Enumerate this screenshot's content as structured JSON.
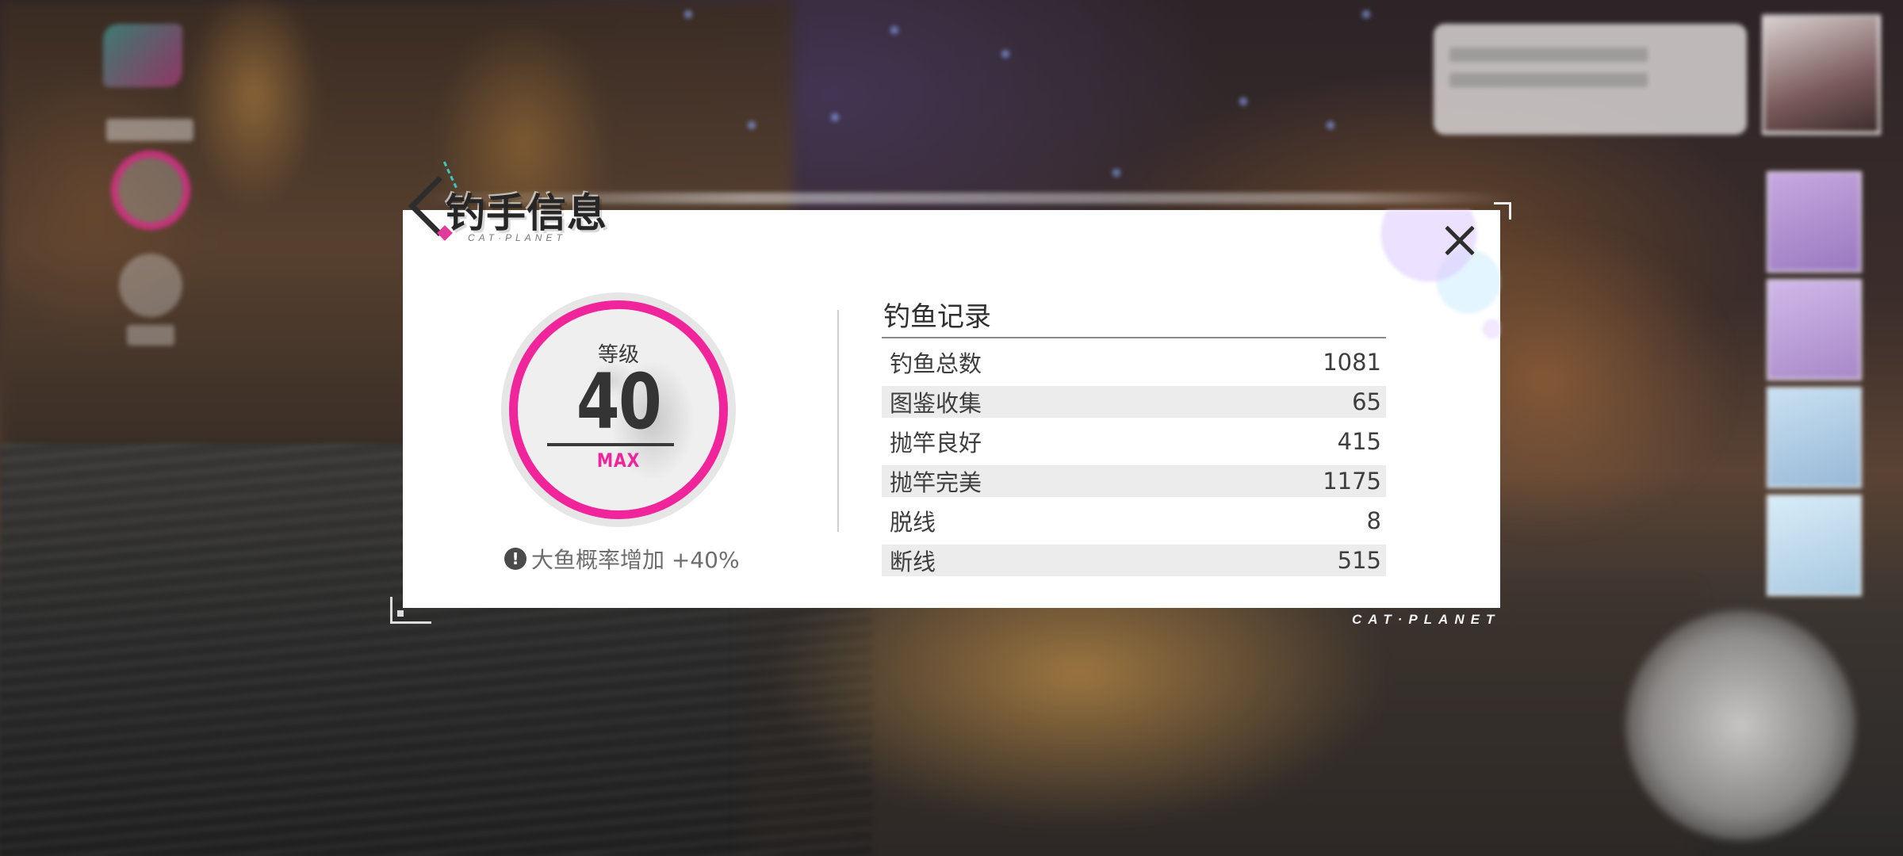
{
  "dialog": {
    "title": "钓手信息",
    "title_sub": "CAT·PLANET",
    "close_icon": "close-x-icon"
  },
  "level_badge": {
    "label": "等级",
    "value": "40",
    "status": "MAX",
    "ring_color": "#f0259b"
  },
  "bonus": {
    "icon": "alert-exclamation-icon",
    "text": "大鱼概率增加 +40%"
  },
  "records": {
    "title": "钓鱼记录",
    "rows": [
      {
        "label": "钓鱼总数",
        "value": "1081"
      },
      {
        "label": "图鉴收集",
        "value": "65"
      },
      {
        "label": "抛竿良好",
        "value": "415"
      },
      {
        "label": "抛竿完美",
        "value": "1175"
      },
      {
        "label": "脱线",
        "value": "8"
      },
      {
        "label": "断线",
        "value": "515"
      }
    ]
  },
  "brand": "CAT·PLANET"
}
